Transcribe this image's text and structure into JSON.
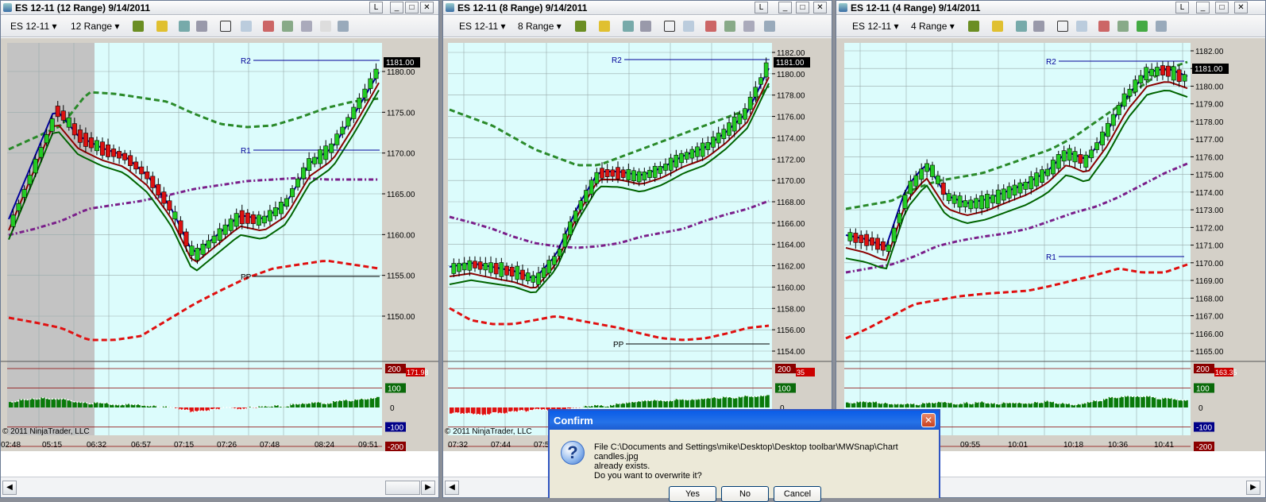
{
  "windows": [
    {
      "title": "ES 12-11 (12 Range)  9/14/2011",
      "instrument": "ES 12-11",
      "range": "12 Range",
      "price_ticks": [
        "1180.00",
        "1175.00",
        "1170.00",
        "1165.00",
        "1160.00",
        "1155.00",
        "1150.00"
      ],
      "time_ticks": [
        "02:48",
        "05:15",
        "06:32",
        "06:57",
        "07:15",
        "07:26",
        "07:48",
        "08:24",
        "09:51"
      ],
      "last_price": "1181.00",
      "pivots": [
        "R2",
        "R1",
        "PP"
      ],
      "osc_ticks": [
        "200",
        "100",
        "0",
        "-100",
        "-200"
      ],
      "osc_value": "171.98",
      "copyright": "© 2011 NinjaTrader, LLC"
    },
    {
      "title": "ES 12-11 (8 Range)  9/14/2011",
      "instrument": "ES 12-11",
      "range": "8 Range",
      "price_ticks": [
        "1182.00",
        "1180.00",
        "1178.00",
        "1176.00",
        "1174.00",
        "1172.00",
        "1170.00",
        "1168.00",
        "1166.00",
        "1164.00",
        "1162.00",
        "1160.00",
        "1158.00",
        "1156.00",
        "1154.00"
      ],
      "time_ticks": [
        "07:32",
        "07:44",
        "07:5"
      ],
      "last_price": "1181.00",
      "pivots": [
        "R2",
        "PP"
      ],
      "osc_ticks": [
        "200",
        "100",
        "0"
      ],
      "osc_value": "35",
      "copyright": "© 2011 NinjaTrader, LLC"
    },
    {
      "title": "ES 12-11 (4 Range)  9/14/2011",
      "instrument": "ES 12-11",
      "range": "4 Range",
      "price_ticks": [
        "1182.00",
        "1181.00",
        "1180.00",
        "1179.00",
        "1178.00",
        "1177.00",
        "1176.00",
        "1175.00",
        "1174.00",
        "1173.00",
        "1172.00",
        "1171.00",
        "1170.00",
        "1169.00",
        "1168.00",
        "1167.00",
        "1166.00",
        "1165.00"
      ],
      "time_ticks": [
        "09:55",
        "10:01",
        "10:18",
        "10:36",
        "10:41"
      ],
      "last_price": "1181.00",
      "pivots": [
        "R2",
        "R1"
      ],
      "osc_ticks": [
        "200",
        "100",
        "0",
        "-100",
        "-200"
      ],
      "osc_value": "163.35"
    }
  ],
  "dialog": {
    "title": "Confirm",
    "line1": "File C:\\Documents and Settings\\mike\\Desktop\\Desktop toolbar\\MWSnap\\Chart candles.jpg",
    "line2": "already exists.",
    "line3": "Do you want to overwrite it?",
    "buttons": [
      "Yes",
      "No",
      "Cancel"
    ]
  },
  "colors": {
    "chart_bg": "#dcfcfc",
    "session_shade": "#c3c3c3",
    "up_candle": "#22cc22",
    "down_candle": "#dd1111",
    "upper_band": "#2a8a2a",
    "lower_band": "#e01010",
    "mid_band": "#7a1f8a",
    "fast_ma": "#000099",
    "slow_ma_red": "#8b0000",
    "slow_ma_green": "#006400"
  }
}
